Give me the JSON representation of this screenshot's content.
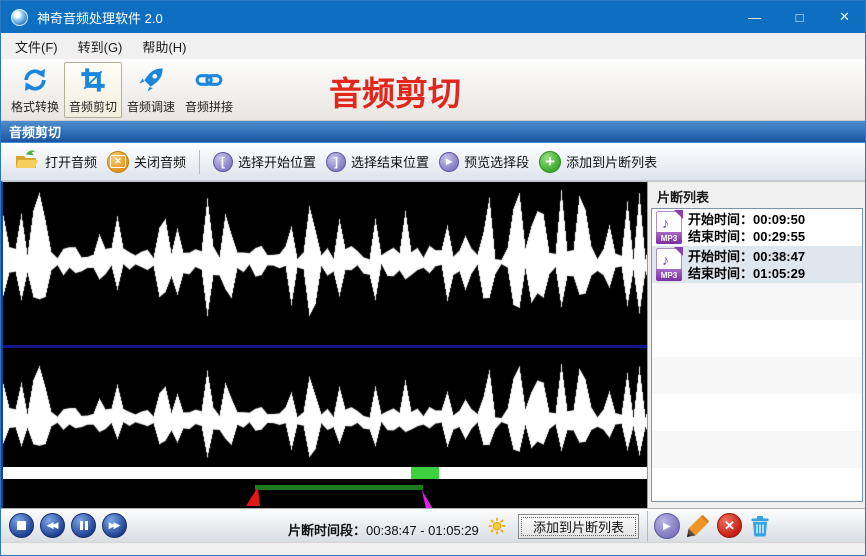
{
  "window": {
    "title": "神奇音频处理软件 2.0",
    "minimize": "—",
    "maximize": "□",
    "close": "✕"
  },
  "menu": {
    "file": "文件(F)",
    "goto": "转到(G)",
    "help": "帮助(H)"
  },
  "toolbar": {
    "format_convert": "格式转换",
    "audio_cut": "音频剪切",
    "audio_speed": "音频调速",
    "audio_join": "音频拼接"
  },
  "page_title": "音频剪切",
  "section_header": "音频剪切",
  "actions": {
    "open_audio": "打开音频",
    "close_audio": "关闭音频",
    "select_start": "选择开始位置",
    "select_end": "选择结束位置",
    "preview_selection": "预览选择段",
    "add_to_list": "添加到片断列表"
  },
  "fragment_panel": {
    "title": "片断列表",
    "items": [
      {
        "format": "MP3",
        "start_label": "开始时间：",
        "start_time": "00:09:50",
        "end_label": "结束时间：",
        "end_time": "00:29:55"
      },
      {
        "format": "MP3",
        "start_label": "开始时间：",
        "start_time": "00:38:47",
        "end_label": "结束时间：",
        "end_time": "01:05:29"
      }
    ]
  },
  "bottom_bar": {
    "range_label": "片断时间段：",
    "range_value": "00:38:47 - 01:05:29",
    "add_button": "添加到片断列表"
  },
  "colors": {
    "titlebar_blue": "#0e6fc1",
    "accent_blue": "#1b87dc",
    "header_red": "#e1261c",
    "section_blue": "#1a55a2",
    "progress_green": "#3ed13e",
    "selection_green": "#1d7a1d",
    "marker_red": "#e01818",
    "marker_magenta": "#e020e0",
    "plus_green": "#3aa92a"
  }
}
